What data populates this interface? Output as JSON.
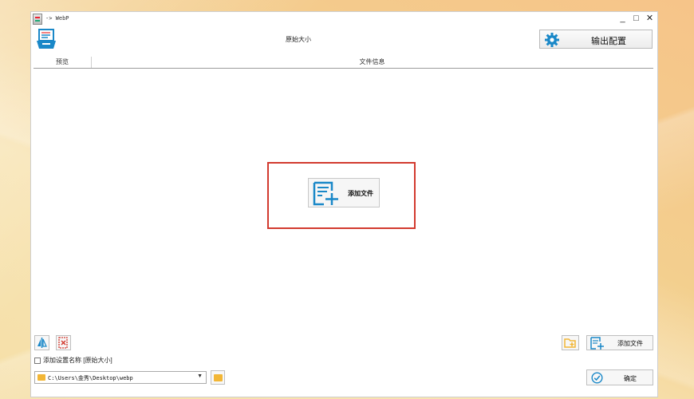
{
  "window": {
    "title": "-> WebP",
    "controls": {
      "minimize": "_",
      "maximize": "□",
      "close": "✕"
    }
  },
  "header": {
    "title": "原始大小",
    "export_label": "输出配置"
  },
  "columns": {
    "preview": "预览",
    "file_info": "文件信息"
  },
  "center": {
    "add_file_label": "添加文件"
  },
  "footer": {
    "add_file_label": "添加文件",
    "checkbox_label": "添加设置名称 [原始大小]",
    "path_value": "C:\\Users\\金秀\\Desktop\\webp",
    "ok_label": "确定"
  },
  "icons": {
    "app": "app-icon",
    "toolbar": "document-tray-icon",
    "export": "gear-icon",
    "center_add": "add-file-icon",
    "rotate": "flip-icon",
    "delete": "delete-icon",
    "add_folder": "add-folder-icon",
    "footer_add": "add-file-icon",
    "folder": "folder-icon",
    "ok": "check-circle-icon"
  },
  "colors": {
    "accent_blue": "#1a88c8",
    "highlight_red": "#d23a2f",
    "folder_yellow": "#f2b636"
  }
}
